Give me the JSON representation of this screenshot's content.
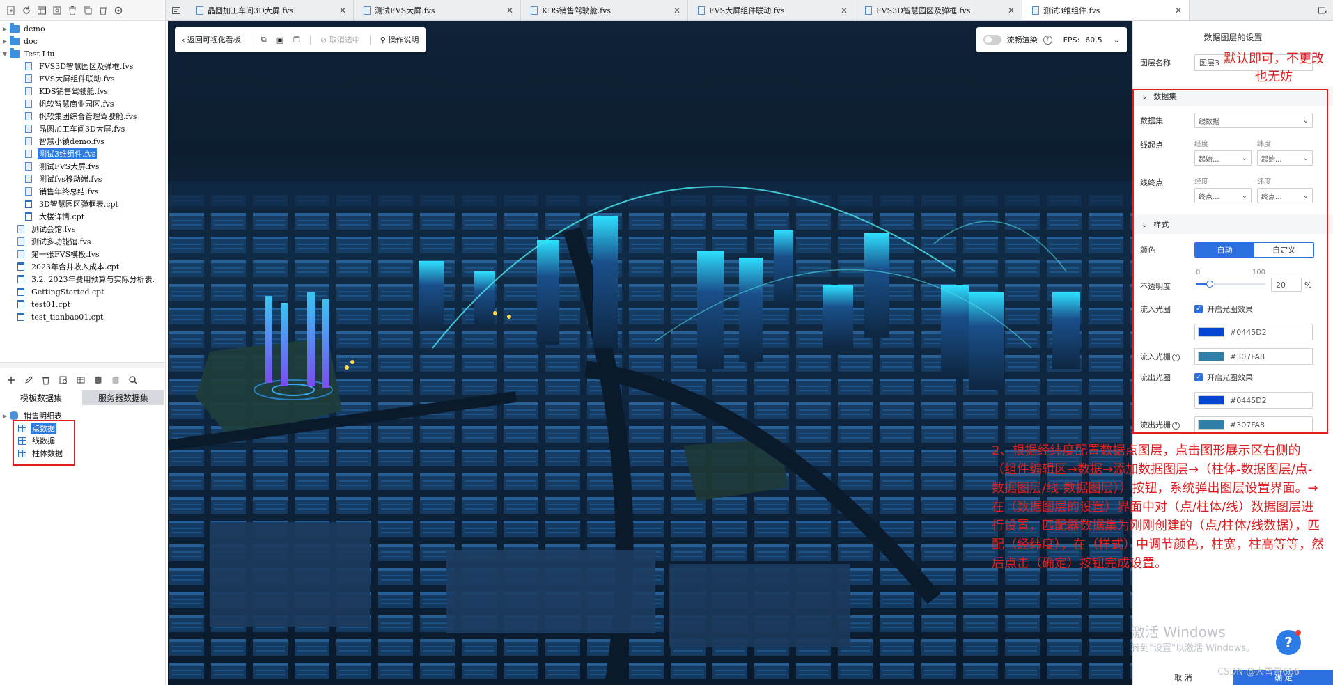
{
  "file_tree": {
    "items": [
      {
        "label": "demo",
        "type": "folder",
        "level": 0,
        "expanded": false
      },
      {
        "label": "doc",
        "type": "folder",
        "level": 0,
        "expanded": false
      },
      {
        "label": "Test Liu",
        "type": "folder",
        "level": 0,
        "expanded": true
      },
      {
        "label": "FVS3D智慧园区及弹框.fvs",
        "type": "fvs",
        "level": 2
      },
      {
        "label": "FVS大屏组件联动.fvs",
        "type": "fvs",
        "level": 2
      },
      {
        "label": "KDS销售驾驶舱.fvs",
        "type": "fvs",
        "level": 2
      },
      {
        "label": "帆软智慧商业园区.fvs",
        "type": "fvs",
        "level": 2
      },
      {
        "label": "帆软集团综合管理驾驶舱.fvs",
        "type": "fvs",
        "level": 2
      },
      {
        "label": "晶圆加工车间3D大屏.fvs",
        "type": "fvs",
        "level": 2
      },
      {
        "label": "智慧小镇demo.fvs",
        "type": "fvs",
        "level": 2
      },
      {
        "label": "测试3维组件.fvs",
        "type": "fvs",
        "level": 2,
        "selected": true
      },
      {
        "label": "测试FVS大屏.fvs",
        "type": "fvs",
        "level": 2
      },
      {
        "label": "测试fvs移动端.fvs",
        "type": "fvs",
        "level": 2
      },
      {
        "label": "销售年终总结.fvs",
        "type": "fvs",
        "level": 2
      },
      {
        "label": "3D智慧园区弹框表.cpt",
        "type": "cpt",
        "level": 2
      },
      {
        "label": "大楼详情.cpt",
        "type": "cpt",
        "level": 2
      },
      {
        "label": "测试会馆.fvs",
        "type": "fvs",
        "level": 1
      },
      {
        "label": "测试多功能馆.fvs",
        "type": "fvs",
        "level": 1
      },
      {
        "label": "第一张FVS模板.fvs",
        "type": "fvs",
        "level": 1
      },
      {
        "label": "2023年合并收入成本.cpt",
        "type": "cpt",
        "level": 1
      },
      {
        "label": "3.2. 2023年费用预算与实际分析表.",
        "type": "cpt",
        "level": 1
      },
      {
        "label": "GettingStarted.cpt",
        "type": "cpt",
        "level": 1
      },
      {
        "label": "test01.cpt",
        "type": "cpt",
        "level": 1
      },
      {
        "label": "test_tianbao01.cpt",
        "type": "cpt",
        "level": 1
      }
    ]
  },
  "dataset_panel": {
    "tabs": [
      "模板数据集",
      "服务器数据集"
    ],
    "active_tab": 0,
    "items": [
      {
        "label": "销售明细表",
        "type": "db",
        "level": 0
      },
      {
        "label": "点数据",
        "type": "table",
        "level": 1,
        "selected": true
      },
      {
        "label": "线数据",
        "type": "table",
        "level": 1
      },
      {
        "label": "柱体数据",
        "type": "table",
        "level": 1
      }
    ]
  },
  "tabs": [
    {
      "label": "晶圆加工车间3D大屏.fvs",
      "active": false
    },
    {
      "label": "测试FVS大屏.fvs",
      "active": false
    },
    {
      "label": "KDS销售驾驶舱.fvs",
      "active": false
    },
    {
      "label": "FVS大屏组件联动.fvs",
      "active": false
    },
    {
      "label": "FVS3D智慧园区及弹框.fvs",
      "active": false
    },
    {
      "label": "测试3维组件.fvs",
      "active": true
    }
  ],
  "canvas_toolbar": {
    "back_label": "返回可视化看板",
    "cancel_label": "取消选中",
    "help_label": "操作说明",
    "flow_render_label": "流畅渲染",
    "fps_label": "FPS:",
    "fps_value": "60.5"
  },
  "settings": {
    "title": "数据图层的设置",
    "layer_name_label": "图层名称",
    "layer_name_value": "图层3",
    "dataset_section": "数据集",
    "dataset_label": "数据集",
    "dataset_value": "线数据",
    "line_start_label": "线起点",
    "line_end_label": "线终点",
    "lng_label": "经度",
    "lat_label": "纬度",
    "start_lng_value": "起始...",
    "start_lat_value": "起始...",
    "end_lng_value": "终点...",
    "end_lat_value": "终点...",
    "style_section": "样式",
    "color_label": "颜色",
    "color_auto": "自动",
    "color_custom": "自定义",
    "opacity_label": "不透明度",
    "opacity_min": "0",
    "opacity_max": "100",
    "opacity_value": "20",
    "opacity_unit": "%",
    "inflow_halo_label": "流入光圈",
    "inflow_halo_check": "开启光圈效果",
    "inflow_halo_color": "#0445D2",
    "inflow_grid_label": "流入光栅",
    "inflow_grid_color": "#307FA8",
    "outflow_halo_label": "流出光圈",
    "outflow_halo_check": "开启光圈效果",
    "outflow_halo_color": "#0445D2",
    "outflow_grid_label": "流出光栅",
    "outflow_grid_color": "#307FA8",
    "cancel_button": "取 消",
    "confirm_button": "确 定"
  },
  "annotations": {
    "top_note": "默认即可，不更改也无妨",
    "bottom_note": "2、根据经纬度配置数据点图层，点击图形展示区右侧的（组件编辑区→数据→添加数据图层→（柱体-数据图层/点-数据图层/线-数据图层））按钮，系统弹出图层设置界面。→在（数据图层的设置）界面中对（点/柱体/线）数据图层进行设置，匹配器数据集为刚刚创建的（点/柱体/线数据），匹配（经纬度），在（样式）中调节颜色，柱宽，柱高等等，然后点击（确定）按钮完成设置。"
  },
  "watermark": {
    "line1": "激活 Windows",
    "line2": "转到\"设置\"以激活 Windows。",
    "csdn": "CSDN @大雪哥666"
  },
  "colors": {
    "accent": "#2d6fe0",
    "annotation_red": "#e02020"
  }
}
